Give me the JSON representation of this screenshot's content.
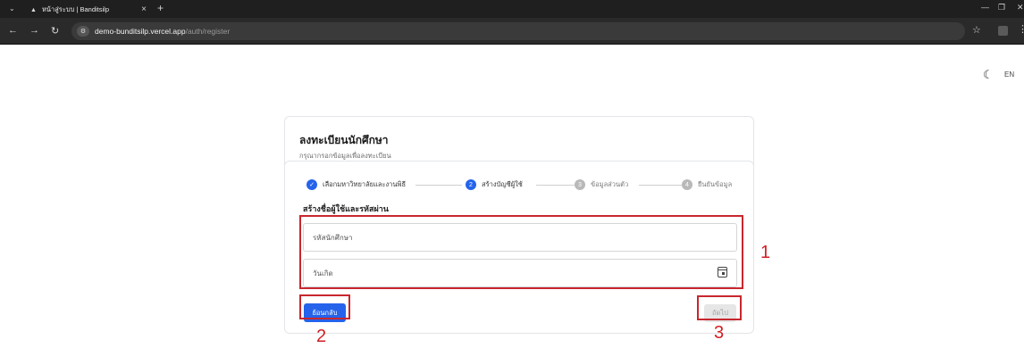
{
  "browser": {
    "tab_title": "หน้าสู่ระบบ | Banditsilp",
    "tab_close": "×",
    "new_tab": "+",
    "url_host": "demo-bunditsilp.vercel.app",
    "url_path": "/auth/register"
  },
  "page": {
    "lang": "EN"
  },
  "header": {
    "title": "ลงทะเบียนนักศึกษา",
    "subtitle": "กรุณากรอกข้อมูลเพื่อลงทะเบียน"
  },
  "stepper": {
    "steps": [
      {
        "num": "✓",
        "label": "เลือกมหาวิทยาลัยและงานพิธี",
        "state": "done"
      },
      {
        "num": "2",
        "label": "สร้างบัญชีผู้ใช้",
        "state": "active"
      },
      {
        "num": "3",
        "label": "ข้อมูลส่วนตัว",
        "state": "todo"
      },
      {
        "num": "4",
        "label": "ยืนยันข้อมูล",
        "state": "todo"
      }
    ]
  },
  "form": {
    "section_title": "สร้างชื่อผู้ใช้และรหัสผ่าน",
    "student_id_placeholder": "รหัสนักศึกษา",
    "birthdate_placeholder": "วันเกิด",
    "back_label": "ย้อนกลับ",
    "next_label": "ถัดไป"
  },
  "annotations": {
    "a1": "1",
    "a2": "2",
    "a3": "3",
    "color": "#d11f26"
  }
}
